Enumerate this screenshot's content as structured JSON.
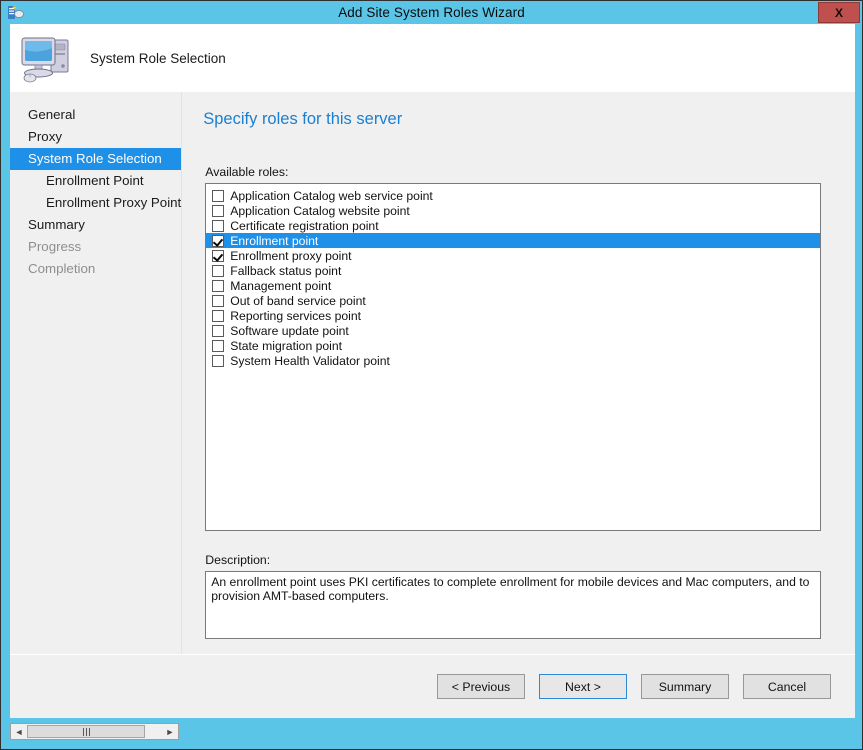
{
  "window": {
    "title": "Add Site System Roles Wizard",
    "close_label": "X",
    "titlebar_icon": "wizard-icon",
    "accent_color": "#5bc5e7",
    "close_color": "#c0504d"
  },
  "header": {
    "title": "System Role Selection",
    "icon": "computer-icon"
  },
  "sidebar": {
    "items": [
      {
        "label": "General",
        "state": "normal",
        "level": 0
      },
      {
        "label": "Proxy",
        "state": "normal",
        "level": 0
      },
      {
        "label": "System Role Selection",
        "state": "active",
        "level": 0
      },
      {
        "label": "Enrollment Point",
        "state": "normal",
        "level": 1
      },
      {
        "label": "Enrollment Proxy Point",
        "state": "normal",
        "level": 1
      },
      {
        "label": "Summary",
        "state": "normal",
        "level": 0
      },
      {
        "label": "Progress",
        "state": "disabled",
        "level": 0
      },
      {
        "label": "Completion",
        "state": "disabled",
        "level": 0
      }
    ],
    "active_color": "#1e90e8"
  },
  "main": {
    "heading": "Specify roles for this server",
    "heading_color": "#1b7fd0",
    "available_roles_label": "Available roles:",
    "roles": [
      {
        "label": "Application Catalog web service point",
        "checked": false,
        "selected": false
      },
      {
        "label": "Application Catalog website point",
        "checked": false,
        "selected": false
      },
      {
        "label": "Certificate registration point",
        "checked": false,
        "selected": false
      },
      {
        "label": "Enrollment point",
        "checked": true,
        "selected": true
      },
      {
        "label": "Enrollment proxy point",
        "checked": true,
        "selected": false
      },
      {
        "label": "Fallback status point",
        "checked": false,
        "selected": false
      },
      {
        "label": "Management point",
        "checked": false,
        "selected": false
      },
      {
        "label": "Out of band service point",
        "checked": false,
        "selected": false
      },
      {
        "label": "Reporting services point",
        "checked": false,
        "selected": false
      },
      {
        "label": "Software update point",
        "checked": false,
        "selected": false
      },
      {
        "label": "State migration point",
        "checked": false,
        "selected": false
      },
      {
        "label": "System Health Validator point",
        "checked": false,
        "selected": false
      }
    ],
    "description_label": "Description:",
    "description_text": "An enrollment point uses PKI certificates to complete enrollment for mobile devices and Mac computers, and to provision AMT-based computers."
  },
  "footer": {
    "buttons": [
      {
        "label": "< Previous",
        "default": false
      },
      {
        "label": "Next >",
        "default": true
      },
      {
        "label": "Summary",
        "default": false
      },
      {
        "label": "Cancel",
        "default": false
      }
    ]
  },
  "scrollbar": {
    "left_arrow": "◄",
    "right_arrow": "►"
  }
}
